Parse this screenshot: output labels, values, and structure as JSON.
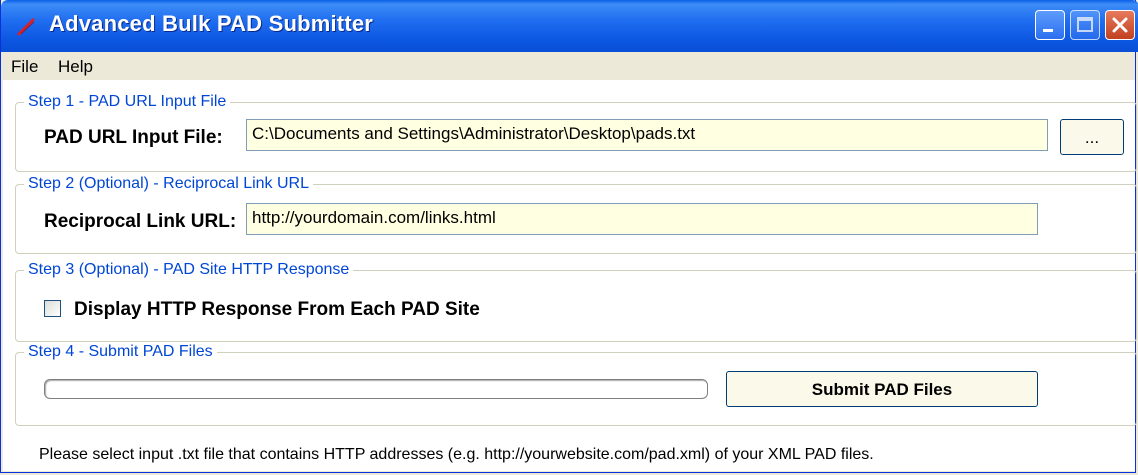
{
  "window": {
    "title": "Advanced Bulk PAD Submitter"
  },
  "menu": {
    "items": [
      "File",
      "Help"
    ]
  },
  "step1": {
    "legend": "Step 1 - PAD URL Input File",
    "label": "PAD URL Input File:",
    "value": "C:\\Documents and Settings\\Administrator\\Desktop\\pads.txt",
    "browse_label": "..."
  },
  "step2": {
    "legend": "Step 2 (Optional) - Reciprocal Link URL",
    "label": "Reciprocal Link URL:",
    "value": "http://yourdomain.com/links.html"
  },
  "step3": {
    "legend": "Step 3 (Optional) - PAD Site HTTP Response",
    "checkbox_label": "Display HTTP Response From Each PAD Site",
    "checked": false
  },
  "step4": {
    "legend": "Step 4 - Submit PAD Files",
    "progress": 0,
    "submit_label": "Submit PAD Files"
  },
  "status": {
    "text": "Please select input .txt file that contains HTTP addresses (e.g. http://yourwebsite.com/pad.xml) of your XML PAD files."
  },
  "colors": {
    "titlebar": "#0a55e0",
    "legend": "#0046d5",
    "textbox_bg": "#ffffe1",
    "close": "#c1401f"
  }
}
